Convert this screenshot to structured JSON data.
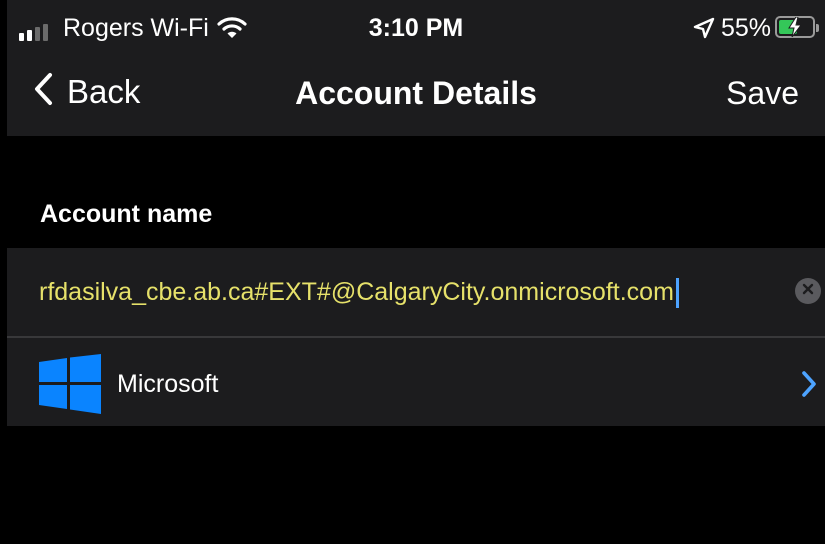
{
  "status_bar": {
    "carrier": "Rogers Wi-Fi",
    "time": "3:10 PM",
    "battery_percent": "55%",
    "battery_level": 0.55,
    "signal_bars_active": 2,
    "signal_bars_total": 4,
    "icons": [
      "signal-icon",
      "wifi-icon",
      "location-arrow-icon",
      "battery-charging-icon"
    ]
  },
  "nav": {
    "back_label": "Back",
    "title": "Account Details",
    "save_label": "Save"
  },
  "section": {
    "header": "Account name"
  },
  "account_input": {
    "value": "rfdasilva_cbe.ab.ca#EXT#@CalgaryCity.onmicrosoft.com"
  },
  "provider_row": {
    "label": "Microsoft",
    "icon": "windows-logo-icon"
  },
  "colors": {
    "background": "#000000",
    "bar": "#1c1c1e",
    "input_text": "#e6e16a",
    "accent": "#4da3ff",
    "windows_blue": "#0a84ff",
    "battery_green": "#34c759"
  }
}
